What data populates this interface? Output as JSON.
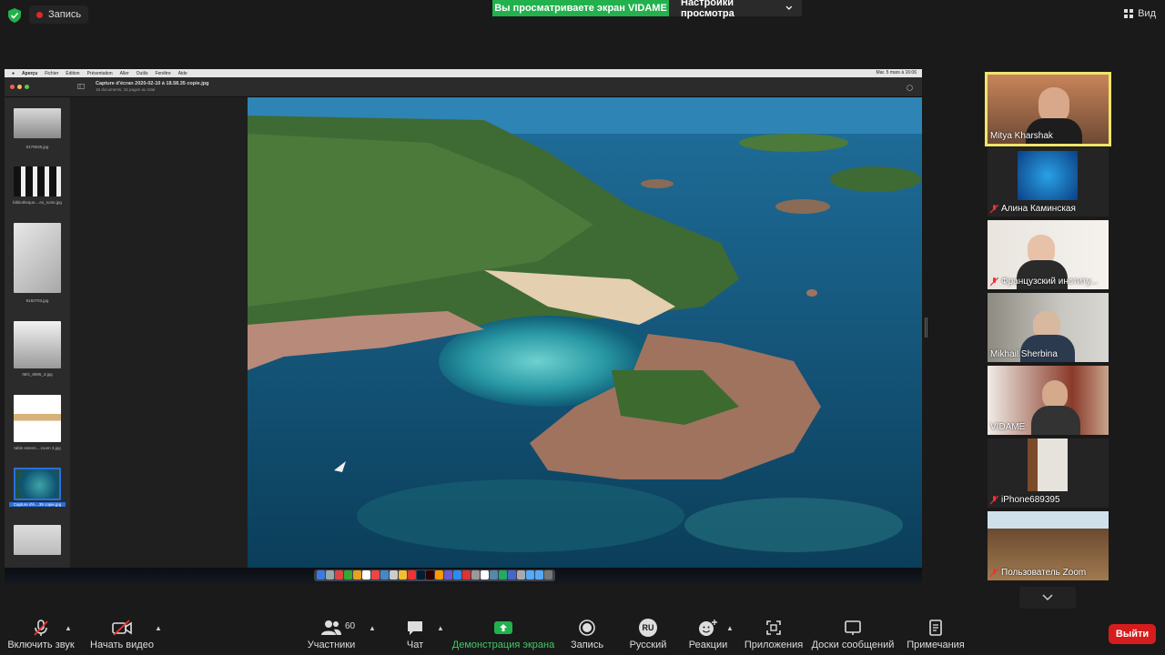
{
  "top": {
    "recording": "Запись",
    "share_banner": "Вы просматриваете экран VIDAME",
    "view_settings": "Настройки просмотра",
    "view": "Вид"
  },
  "shared_screen": {
    "menubar": [
      "Aperçu",
      "Fichier",
      "Édition",
      "Présentation",
      "Aller",
      "Outils",
      "Fenêtre",
      "Aide"
    ],
    "menubar_right": "Mar. 5 mars à 16:06",
    "window_title": "Capture d'écran 2020-02-10 à 18.58.35 copie.jpg",
    "window_subtitle": "15 documents, 15 pages au total",
    "thumbnails": [
      {
        "label": "9179535.jpg"
      },
      {
        "label": "bibliotheque....es_noire.jpg"
      },
      {
        "label": "9183793.jpg"
      },
      {
        "label": "IMG_8995_3.jpg"
      },
      {
        "label": "table extens....zoom 3.jpg"
      },
      {
        "label": "Capture d'é....35 copie.jpg"
      },
      {
        "label": ""
      }
    ]
  },
  "participants": [
    {
      "name": "Mitya Kharshak",
      "muted": false,
      "active": true
    },
    {
      "name": "Алина Каминская",
      "muted": true
    },
    {
      "name": "Французский институ...",
      "muted": true
    },
    {
      "name": "Mikhail Sherbina",
      "muted": false
    },
    {
      "name": "VIDAME",
      "muted": false
    },
    {
      "name": "iPhone689395",
      "muted": true
    },
    {
      "name": "Пользователь Zoom",
      "muted": true
    }
  ],
  "toolbar": {
    "audio": "Включить звук",
    "video": "Начать видео",
    "participants": "Участники",
    "participants_count": "60",
    "chat": "Чат",
    "share": "Демонстрация экрана",
    "record": "Запись",
    "language": "Русский",
    "language_code": "RU",
    "reactions": "Реакции",
    "apps": "Приложения",
    "whiteboards": "Доски сообщений",
    "notes": "Примечания",
    "leave": "Выйти"
  }
}
